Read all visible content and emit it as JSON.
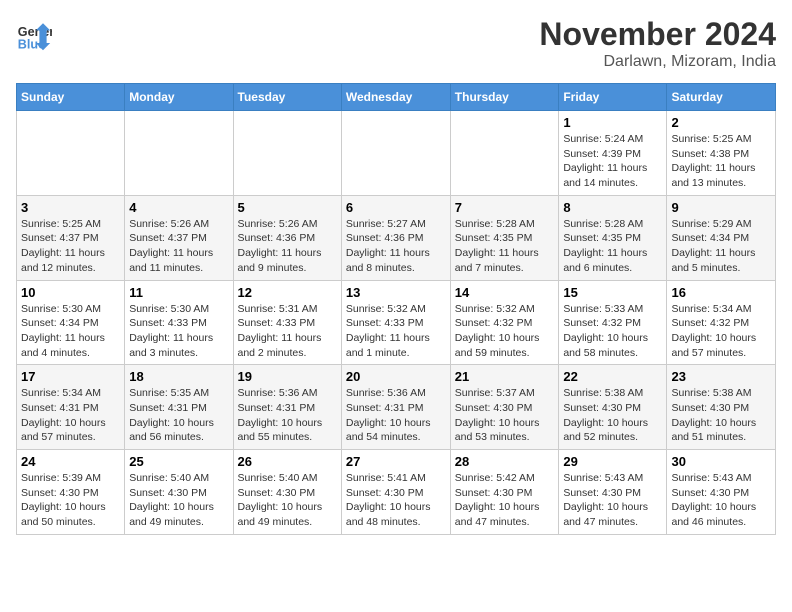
{
  "header": {
    "logo_line1": "General",
    "logo_line2": "Blue",
    "month_title": "November 2024",
    "location": "Darlawn, Mizoram, India"
  },
  "weekdays": [
    "Sunday",
    "Monday",
    "Tuesday",
    "Wednesday",
    "Thursday",
    "Friday",
    "Saturday"
  ],
  "weeks": [
    [
      {
        "day": "",
        "info": ""
      },
      {
        "day": "",
        "info": ""
      },
      {
        "day": "",
        "info": ""
      },
      {
        "day": "",
        "info": ""
      },
      {
        "day": "",
        "info": ""
      },
      {
        "day": "1",
        "info": "Sunrise: 5:24 AM\nSunset: 4:39 PM\nDaylight: 11 hours and 14 minutes."
      },
      {
        "day": "2",
        "info": "Sunrise: 5:25 AM\nSunset: 4:38 PM\nDaylight: 11 hours and 13 minutes."
      }
    ],
    [
      {
        "day": "3",
        "info": "Sunrise: 5:25 AM\nSunset: 4:37 PM\nDaylight: 11 hours and 12 minutes."
      },
      {
        "day": "4",
        "info": "Sunrise: 5:26 AM\nSunset: 4:37 PM\nDaylight: 11 hours and 11 minutes."
      },
      {
        "day": "5",
        "info": "Sunrise: 5:26 AM\nSunset: 4:36 PM\nDaylight: 11 hours and 9 minutes."
      },
      {
        "day": "6",
        "info": "Sunrise: 5:27 AM\nSunset: 4:36 PM\nDaylight: 11 hours and 8 minutes."
      },
      {
        "day": "7",
        "info": "Sunrise: 5:28 AM\nSunset: 4:35 PM\nDaylight: 11 hours and 7 minutes."
      },
      {
        "day": "8",
        "info": "Sunrise: 5:28 AM\nSunset: 4:35 PM\nDaylight: 11 hours and 6 minutes."
      },
      {
        "day": "9",
        "info": "Sunrise: 5:29 AM\nSunset: 4:34 PM\nDaylight: 11 hours and 5 minutes."
      }
    ],
    [
      {
        "day": "10",
        "info": "Sunrise: 5:30 AM\nSunset: 4:34 PM\nDaylight: 11 hours and 4 minutes."
      },
      {
        "day": "11",
        "info": "Sunrise: 5:30 AM\nSunset: 4:33 PM\nDaylight: 11 hours and 3 minutes."
      },
      {
        "day": "12",
        "info": "Sunrise: 5:31 AM\nSunset: 4:33 PM\nDaylight: 11 hours and 2 minutes."
      },
      {
        "day": "13",
        "info": "Sunrise: 5:32 AM\nSunset: 4:33 PM\nDaylight: 11 hours and 1 minute."
      },
      {
        "day": "14",
        "info": "Sunrise: 5:32 AM\nSunset: 4:32 PM\nDaylight: 10 hours and 59 minutes."
      },
      {
        "day": "15",
        "info": "Sunrise: 5:33 AM\nSunset: 4:32 PM\nDaylight: 10 hours and 58 minutes."
      },
      {
        "day": "16",
        "info": "Sunrise: 5:34 AM\nSunset: 4:32 PM\nDaylight: 10 hours and 57 minutes."
      }
    ],
    [
      {
        "day": "17",
        "info": "Sunrise: 5:34 AM\nSunset: 4:31 PM\nDaylight: 10 hours and 57 minutes."
      },
      {
        "day": "18",
        "info": "Sunrise: 5:35 AM\nSunset: 4:31 PM\nDaylight: 10 hours and 56 minutes."
      },
      {
        "day": "19",
        "info": "Sunrise: 5:36 AM\nSunset: 4:31 PM\nDaylight: 10 hours and 55 minutes."
      },
      {
        "day": "20",
        "info": "Sunrise: 5:36 AM\nSunset: 4:31 PM\nDaylight: 10 hours and 54 minutes."
      },
      {
        "day": "21",
        "info": "Sunrise: 5:37 AM\nSunset: 4:30 PM\nDaylight: 10 hours and 53 minutes."
      },
      {
        "day": "22",
        "info": "Sunrise: 5:38 AM\nSunset: 4:30 PM\nDaylight: 10 hours and 52 minutes."
      },
      {
        "day": "23",
        "info": "Sunrise: 5:38 AM\nSunset: 4:30 PM\nDaylight: 10 hours and 51 minutes."
      }
    ],
    [
      {
        "day": "24",
        "info": "Sunrise: 5:39 AM\nSunset: 4:30 PM\nDaylight: 10 hours and 50 minutes."
      },
      {
        "day": "25",
        "info": "Sunrise: 5:40 AM\nSunset: 4:30 PM\nDaylight: 10 hours and 49 minutes."
      },
      {
        "day": "26",
        "info": "Sunrise: 5:40 AM\nSunset: 4:30 PM\nDaylight: 10 hours and 49 minutes."
      },
      {
        "day": "27",
        "info": "Sunrise: 5:41 AM\nSunset: 4:30 PM\nDaylight: 10 hours and 48 minutes."
      },
      {
        "day": "28",
        "info": "Sunrise: 5:42 AM\nSunset: 4:30 PM\nDaylight: 10 hours and 47 minutes."
      },
      {
        "day": "29",
        "info": "Sunrise: 5:43 AM\nSunset: 4:30 PM\nDaylight: 10 hours and 47 minutes."
      },
      {
        "day": "30",
        "info": "Sunrise: 5:43 AM\nSunset: 4:30 PM\nDaylight: 10 hours and 46 minutes."
      }
    ]
  ]
}
